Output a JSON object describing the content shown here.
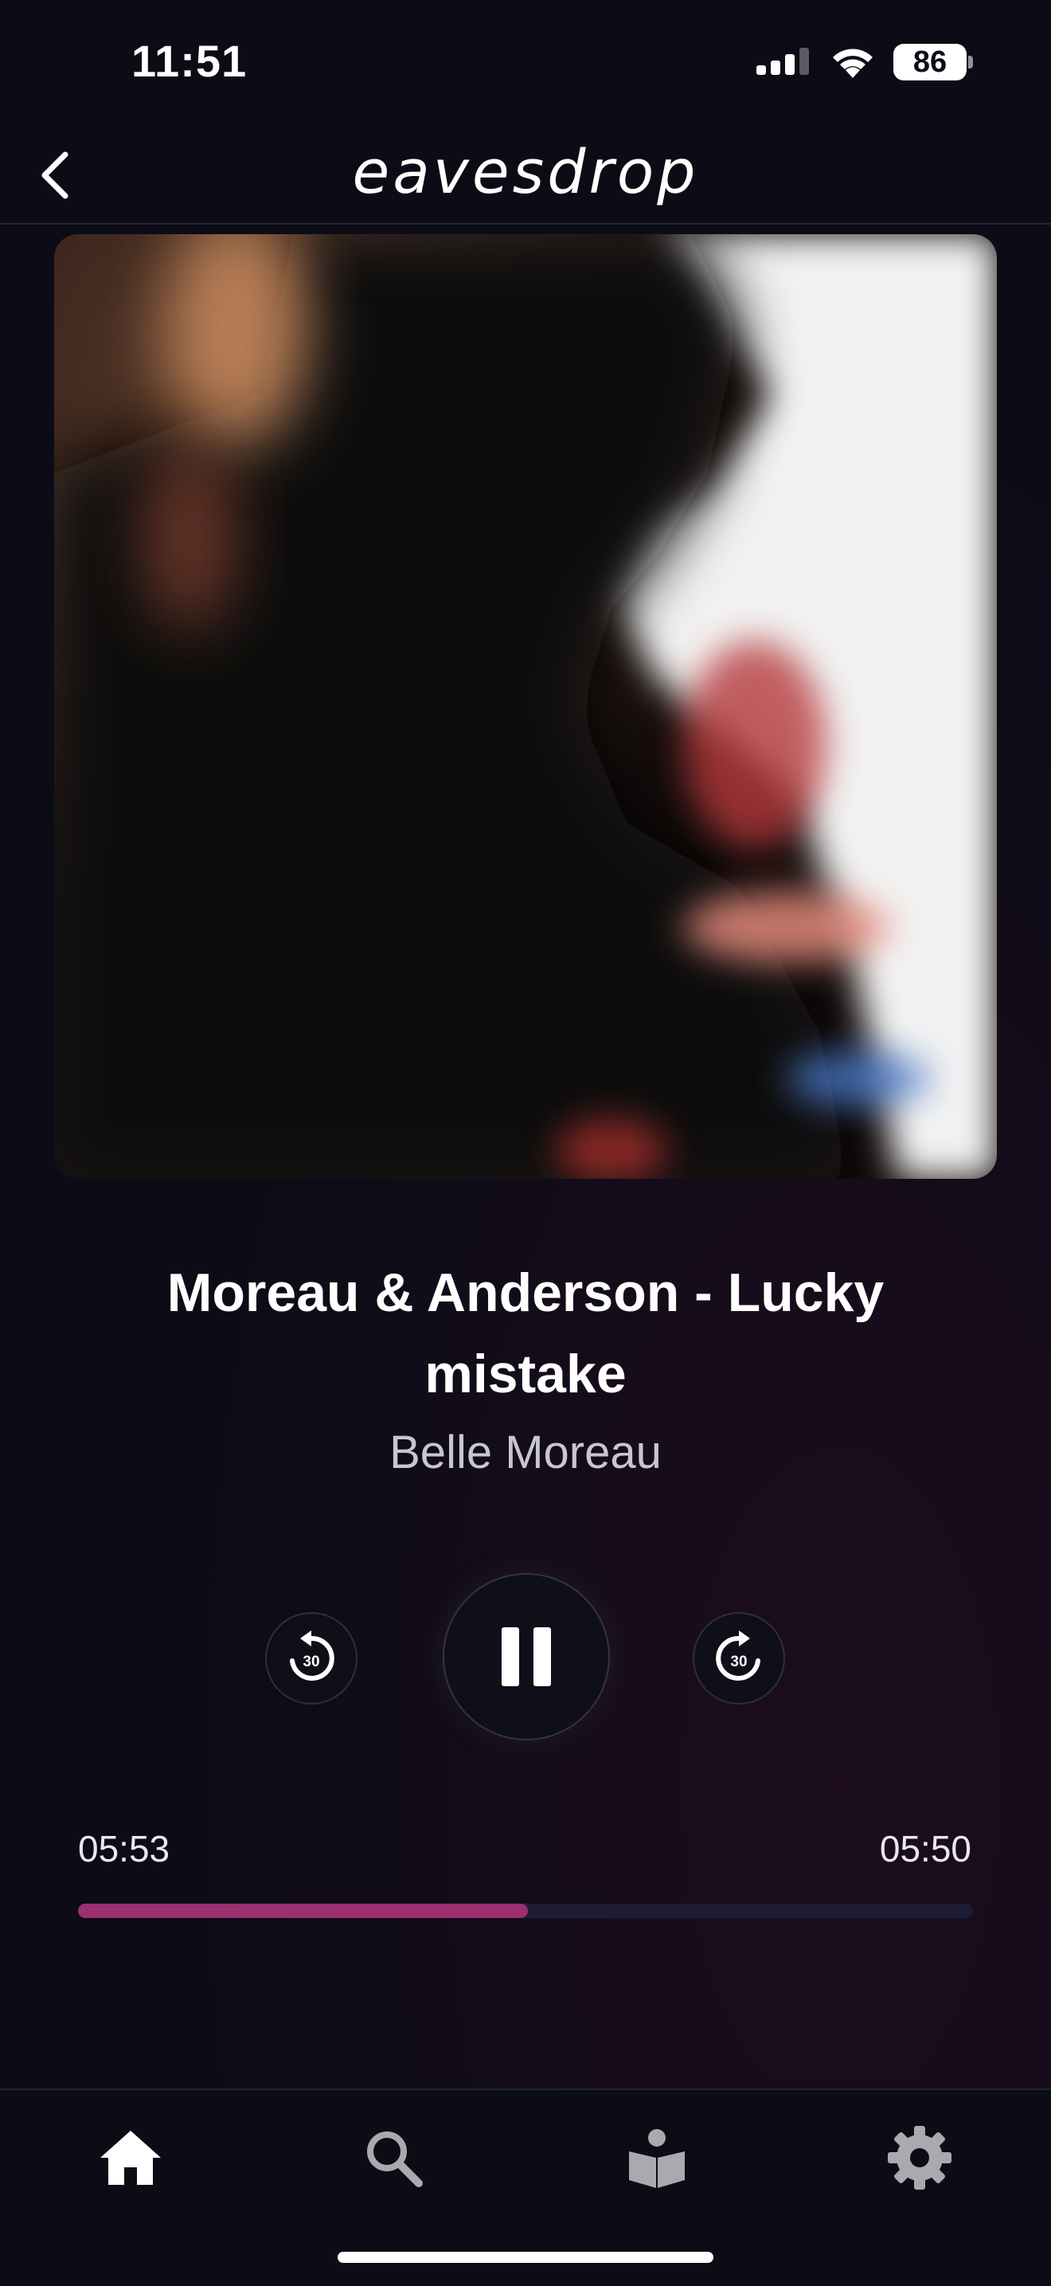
{
  "status_bar": {
    "time": "11:51",
    "battery": "86",
    "icons": [
      "signal-icon",
      "wifi-icon",
      "battery-icon"
    ]
  },
  "header": {
    "logo_text": "eavesdrop",
    "back_icon": "chevron-left-icon"
  },
  "track": {
    "title": "Moreau & Anderson - Lucky mistake",
    "artist": "Belle Moreau"
  },
  "controls": {
    "skip_back_label": "30",
    "skip_forward_label": "30",
    "state": "playing"
  },
  "progress": {
    "elapsed": "05:53",
    "total": "05:50",
    "fraction": 0.503
  },
  "tab_bar": {
    "tabs": [
      {
        "name": "home",
        "icon": "home-icon",
        "active": true
      },
      {
        "name": "search",
        "icon": "search-icon",
        "active": false
      },
      {
        "name": "library",
        "icon": "reader-icon",
        "active": false
      },
      {
        "name": "settings",
        "icon": "gear-icon",
        "active": false
      }
    ]
  },
  "colors": {
    "background": "#0c0c17",
    "accent": "#9c2f6e",
    "progress_track": "#1d1c34",
    "active_tab": "#ffffff",
    "inactive_tab": "#a9a9ae"
  }
}
